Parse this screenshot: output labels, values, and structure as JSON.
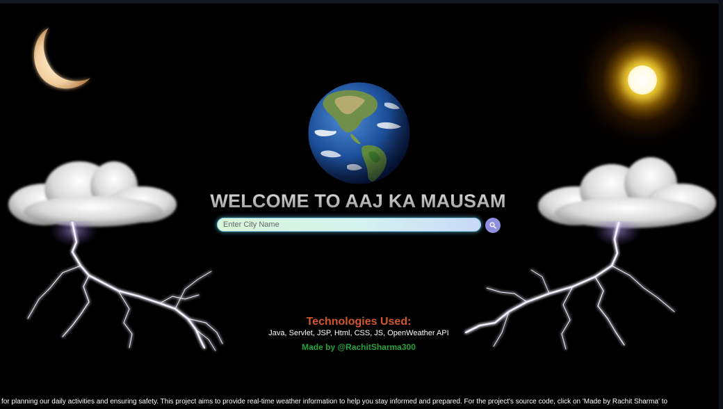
{
  "header": {
    "title": "WELCOME TO AAJ KA MAUSAM"
  },
  "search": {
    "placeholder": "Enter City Name",
    "value": "",
    "button_icon": "search-icon"
  },
  "decorations": {
    "icons": [
      "moon-icon",
      "sun-icon",
      "earth-globe-icon",
      "cloud-icon",
      "lightning-bolt-icon"
    ]
  },
  "footer": {
    "tech_heading": "Technologies Used:",
    "tech_list": "Java, Servlet, JSP, Html, CSS, JS, OpenWeather API",
    "made_by": "Made by @RachitSharma300",
    "scrolling_text": "for planning our daily activities and ensuring safety. This project aims to provide real-time weather information to help you stay informed and prepared. For the project's source code, click on 'Made by Rachit Sharma' to"
  },
  "colors": {
    "background": "#000000",
    "tech_heading": "#d2572a",
    "made_by": "#24a33a",
    "search_button": "#8f8fe0",
    "search_glow": "#7fd0f0"
  }
}
